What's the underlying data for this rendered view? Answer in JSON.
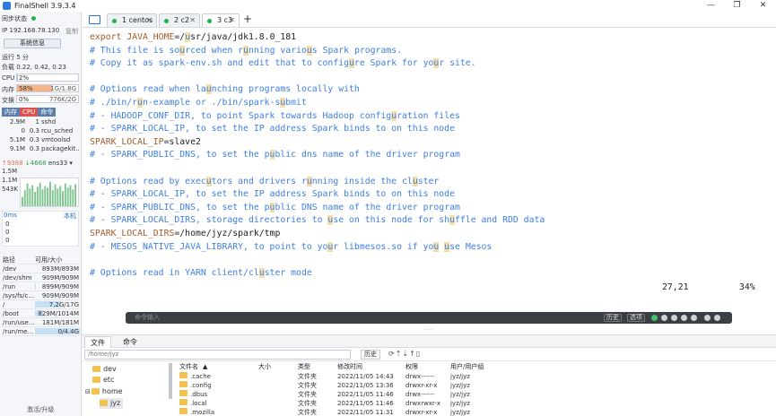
{
  "window": {
    "title": "FinalShell 3.9.3.4",
    "controls": [
      "—",
      "❐",
      "✕"
    ]
  },
  "sidebar": {
    "sync_status": "同步状态",
    "status_dot_color": "#22b14c",
    "ip_label": "IP 192.168.78.130",
    "copy_label": "复制",
    "sysinfo_button": "系统信息",
    "uptime": "运行 5 分",
    "load": "负载 0.22, 0.42, 0.23",
    "cpu": {
      "label": "CPU",
      "value": "2%",
      "percent": 2
    },
    "mem": {
      "label": "内存",
      "value": "58%",
      "detail": "1G/1.8G",
      "percent": 58
    },
    "swap": {
      "label": "交换",
      "value": "0%",
      "detail": "776K/2G",
      "percent": 0
    },
    "proc_tabs": [
      "内存",
      "CPU",
      "命令"
    ],
    "processes": [
      {
        "mem": "2.9M",
        "cpu": "1",
        "cmd": "sshd"
      },
      {
        "mem": "0",
        "cpu": "0.3",
        "cmd": "rcu_sched"
      },
      {
        "mem": "5.1M",
        "cpu": "0.3",
        "cmd": "vmtoolsd"
      },
      {
        "mem": "9.1M",
        "cpu": "0.3",
        "cmd": "packagekit..."
      }
    ],
    "net": {
      "up": "↑9388",
      "down": "↓4668",
      "iface": "ens33",
      "scale": [
        "1.5M",
        "1.1M",
        "543K"
      ]
    },
    "ping": {
      "label": "0ms",
      "host": "本机",
      "values": [
        "0",
        "0",
        "0"
      ]
    },
    "disk_header": {
      "path": "路径",
      "usage": "可用/大小"
    },
    "disks": [
      {
        "path": "/dev",
        "usage": "893M/893M",
        "used": 0
      },
      {
        "path": "/dev/shm",
        "usage": "909M/909M",
        "used": 0
      },
      {
        "path": "/run",
        "usage": "899M/909M",
        "used": 0.01
      },
      {
        "path": "/sys/fs/c...",
        "usage": "909M/909M",
        "used": 0
      },
      {
        "path": "/",
        "usage": "7.2G/17G",
        "used": 0.58
      },
      {
        "path": "/boot",
        "usage": "829M/1014M",
        "used": 0.18
      },
      {
        "path": "/run/use...",
        "usage": "181M/181M",
        "used": 0
      },
      {
        "path": "/run/me...",
        "usage": "0/4.4G",
        "used": 1
      }
    ],
    "activate": "激活/升级"
  },
  "tabs": [
    {
      "label": "1 centos",
      "active": false
    },
    {
      "label": "2 c2",
      "active": false
    },
    {
      "label": "3 c3",
      "active": true
    }
  ],
  "editor": {
    "lines": [
      [
        {
          "t": "export ",
          "c": "kw"
        },
        {
          "t": "JAVA_HOME",
          "c": "kw"
        },
        {
          "t": "=/",
          "c": "pl"
        },
        {
          "t": "u",
          "c": "hl"
        },
        {
          "t": "sr/java/jdk1.8.0_181",
          "c": "pl"
        }
      ],
      [
        {
          "t": "# This file is so",
          "c": "cm"
        },
        {
          "t": "u",
          "c": "hl"
        },
        {
          "t": "rced when r",
          "c": "cm"
        },
        {
          "t": "u",
          "c": "hl"
        },
        {
          "t": "nning vario",
          "c": "cm"
        },
        {
          "t": "u",
          "c": "hl"
        },
        {
          "t": "s Spark programs.",
          "c": "cm"
        }
      ],
      [
        {
          "t": "# Copy it as spark-env.sh and edit that to config",
          "c": "cm"
        },
        {
          "t": "u",
          "c": "hl"
        },
        {
          "t": "re Spark for yo",
          "c": "cm"
        },
        {
          "t": "u",
          "c": "hl"
        },
        {
          "t": "r site.",
          "c": "cm"
        }
      ],
      [],
      [
        {
          "t": "# Options read when la",
          "c": "cm"
        },
        {
          "t": "u",
          "c": "hl"
        },
        {
          "t": "nching programs locally with",
          "c": "cm"
        }
      ],
      [
        {
          "t": "# ./bin/r",
          "c": "cm"
        },
        {
          "t": "u",
          "c": "hl"
        },
        {
          "t": "n-example or ./bin/spark-s",
          "c": "cm"
        },
        {
          "t": "u",
          "c": "hl"
        },
        {
          "t": "bmit",
          "c": "cm"
        }
      ],
      [
        {
          "t": "# - HADOOP_CONF_DIR, to point Spark towards Hadoop config",
          "c": "cm"
        },
        {
          "t": "u",
          "c": "hl"
        },
        {
          "t": "ration files",
          "c": "cm"
        }
      ],
      [
        {
          "t": "# - SPARK_LOCAL_IP, to set the IP address Spark binds to on this node",
          "c": "cm"
        }
      ],
      [
        {
          "t": "SPARK_LOCAL_IP",
          "c": "kw"
        },
        {
          "t": "=slave2",
          "c": "pl"
        }
      ],
      [
        {
          "t": "# - SPARK_PUBLIC_DNS, to set the p",
          "c": "cm"
        },
        {
          "t": "u",
          "c": "hl"
        },
        {
          "t": "blic dns name of the driver program",
          "c": "cm"
        }
      ],
      [],
      [
        {
          "t": "# Options read by exec",
          "c": "cm"
        },
        {
          "t": "u",
          "c": "hl"
        },
        {
          "t": "tors and drivers r",
          "c": "cm"
        },
        {
          "t": "u",
          "c": "hl"
        },
        {
          "t": "nning inside the cl",
          "c": "cm"
        },
        {
          "t": "u",
          "c": "hl"
        },
        {
          "t": "ster",
          "c": "cm"
        }
      ],
      [
        {
          "t": "# - SPARK_LOCAL_IP, to set the IP address Spark binds to on this node",
          "c": "cm"
        }
      ],
      [
        {
          "t": "# - SPARK_PUBLIC_DNS, to set the p",
          "c": "cm"
        },
        {
          "t": "u",
          "c": "hl"
        },
        {
          "t": "blic DNS name of the driver program",
          "c": "cm"
        }
      ],
      [
        {
          "t": "# - SPARK_LOCAL_DIRS, storage directories to ",
          "c": "cm"
        },
        {
          "t": "u",
          "c": "hl"
        },
        {
          "t": "se on this node for sh",
          "c": "cm"
        },
        {
          "t": "u",
          "c": "hl"
        },
        {
          "t": "ffle and RDD data",
          "c": "cm"
        }
      ],
      [
        {
          "t": "SPARK_LOCAL_DIRS",
          "c": "kw"
        },
        {
          "t": "=/home/jyz/spark/tmp",
          "c": "pl"
        }
      ],
      [
        {
          "t": "# - MESOS_NATIVE_JAVA_LIBRARY, to point to yo",
          "c": "cm"
        },
        {
          "t": "u",
          "c": "hl"
        },
        {
          "t": "r libmesos.so if yo",
          "c": "cm"
        },
        {
          "t": "u",
          "c": "hl"
        },
        {
          "t": " ",
          "c": "cm"
        },
        {
          "t": "u",
          "c": "hl"
        },
        {
          "t": "se Mesos",
          "c": "cm"
        }
      ],
      [],
      [
        {
          "t": "# Options read in YARN client/cl",
          "c": "cm"
        },
        {
          "t": "u",
          "c": "hl"
        },
        {
          "t": "ster mode",
          "c": "cm"
        }
      ]
    ],
    "cursor_pos": "27,21",
    "percent": "34%"
  },
  "cmdbar": {
    "placeholder": "命令输入",
    "history_btn": "历史",
    "option_btn": "选项"
  },
  "filemanager": {
    "tabs": [
      "文件",
      "命令"
    ],
    "path": "/home/jyz",
    "history_btn": "历史",
    "tree": [
      "dev",
      "etc",
      "home",
      "jyz"
    ],
    "columns": [
      "文件名",
      "大小",
      "类型",
      "修改时间",
      "权限",
      "用户/用户组"
    ],
    "files": [
      {
        "name": ".cache",
        "size": "",
        "type": "文件夹",
        "mtime": "2022/11/05 14:43",
        "perm": "drwx------",
        "owner": "jyz/jyz"
      },
      {
        "name": ".config",
        "size": "",
        "type": "文件夹",
        "mtime": "2022/11/05 13:36",
        "perm": "drwxr-xr-x",
        "owner": "jyz/jyz"
      },
      {
        "name": ".dbus",
        "size": "",
        "type": "文件夹",
        "mtime": "2022/11/05 11:46",
        "perm": "drwx------",
        "owner": "jyz/jyz"
      },
      {
        "name": ".local",
        "size": "",
        "type": "文件夹",
        "mtime": "2022/11/05 11:46",
        "perm": "drwxrwxr-x",
        "owner": "jyz/jyz"
      },
      {
        "name": ".mozilla",
        "size": "",
        "type": "文件夹",
        "mtime": "2022/11/05 11:31",
        "perm": "drwxr-xr-x",
        "owner": "jyz/jyz"
      }
    ]
  }
}
